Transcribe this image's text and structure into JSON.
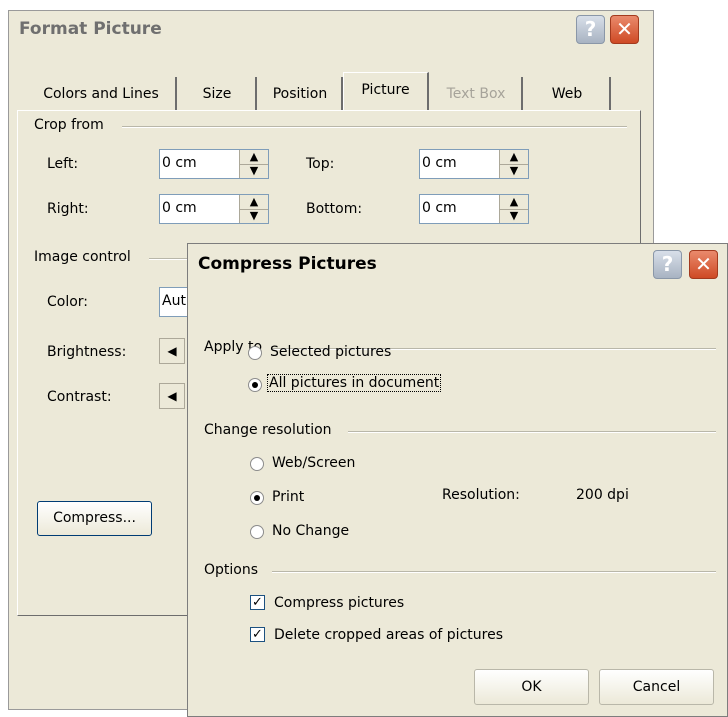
{
  "format_picture": {
    "title": "Format Picture",
    "help_glyph": "?",
    "close_glyph": "✕",
    "tabs": [
      {
        "label": "Colors and Lines",
        "state": "normal"
      },
      {
        "label": "Size",
        "state": "normal"
      },
      {
        "label": "Position",
        "state": "normal"
      },
      {
        "label": "Picture",
        "state": "active"
      },
      {
        "label": "Text Box",
        "state": "disabled"
      },
      {
        "label": "Web",
        "state": "normal"
      }
    ],
    "crop_group": "Crop from",
    "left_label": "Left:",
    "left_value": "0 cm",
    "top_label": "Top:",
    "top_value": "0 cm",
    "right_label": "Right:",
    "right_value": "0 cm",
    "bottom_label": "Bottom:",
    "bottom_value": "0 cm",
    "image_group": "Image control",
    "color_label": "Color:",
    "color_value": "Aut",
    "brightness_label": "Brightness:",
    "contrast_label": "Contrast:",
    "compress_button": "Compress..."
  },
  "compress": {
    "title": "Compress Pictures",
    "help_glyph": "?",
    "close_glyph": "✕",
    "apply_group": "Apply to",
    "selected_pictures": "Selected pictures",
    "all_pictures": "All pictures in document",
    "apply_selected": "all",
    "resolution_group": "Change resolution",
    "web_screen": "Web/Screen",
    "print": "Print",
    "no_change": "No Change",
    "resolution_selected": "print",
    "resolution_label": "Resolution:",
    "resolution_value": "200 dpi",
    "options_group": "Options",
    "compress_pictures": "Compress pictures",
    "compress_pictures_checked": true,
    "delete_cropped": "Delete cropped areas of pictures",
    "delete_cropped_checked": true,
    "ok": "OK",
    "cancel": "Cancel"
  },
  "icons": {
    "spin_up": "▲",
    "spin_down": "▼",
    "scroll_left": "◀",
    "checkmark": "✓"
  }
}
